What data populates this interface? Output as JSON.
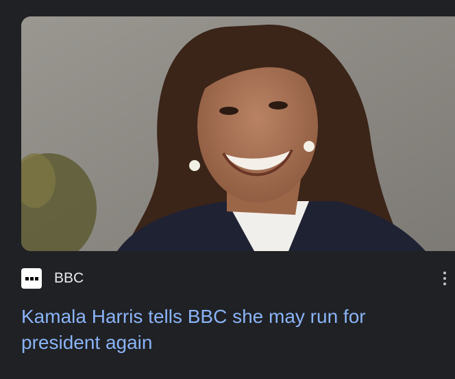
{
  "article": {
    "source": "BBC",
    "favicon_icon": "bbc-favicon-icon",
    "more_icon": "more-vertical-icon",
    "headline": "Kamala Harris tells BBC she may run for president again"
  },
  "colors": {
    "background": "#202124",
    "headline_link": "#8ab4f8",
    "source_text": "#e8eaed"
  }
}
